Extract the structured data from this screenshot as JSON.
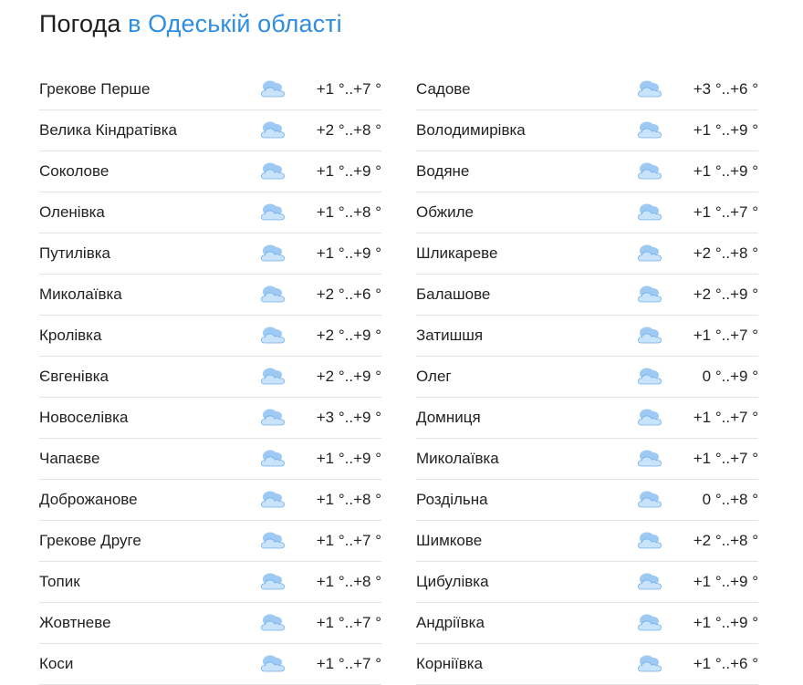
{
  "header": {
    "title_prefix": "Погода",
    "title_region": "в Одеській області"
  },
  "icon": {
    "name": "cloudy-icon",
    "cloud_back": "#9ec9f2",
    "cloud_front": "#c9e3fa",
    "cloud_stroke": "#6fb0ec"
  },
  "left": [
    {
      "city": "Грекове Перше",
      "temp": "+1 °..+7 °"
    },
    {
      "city": "Велика Кіндратівка",
      "temp": "+2 °..+8 °"
    },
    {
      "city": "Соколове",
      "temp": "+1 °..+9 °"
    },
    {
      "city": "Оленівка",
      "temp": "+1 °..+8 °"
    },
    {
      "city": "Путилівка",
      "temp": "+1 °..+9 °"
    },
    {
      "city": "Миколаївка",
      "temp": "+2 °..+6 °"
    },
    {
      "city": "Кролівка",
      "temp": "+2 °..+9 °"
    },
    {
      "city": "Євгенівка",
      "temp": "+2 °..+9 °"
    },
    {
      "city": "Новоселівка",
      "temp": "+3 °..+9 °"
    },
    {
      "city": "Чапаєве",
      "temp": "+1 °..+9 °"
    },
    {
      "city": "Доброжанове",
      "temp": "+1 °..+8 °"
    },
    {
      "city": "Грекове Друге",
      "temp": "+1 °..+7 °"
    },
    {
      "city": "Топик",
      "temp": "+1 °..+8 °"
    },
    {
      "city": "Жовтневе",
      "temp": "+1 °..+7 °"
    },
    {
      "city": "Коси",
      "temp": "+1 °..+7 °"
    }
  ],
  "right": [
    {
      "city": "Садове",
      "temp": "+3 °..+6 °"
    },
    {
      "city": "Володимирівка",
      "temp": "+1 °..+9 °"
    },
    {
      "city": "Водяне",
      "temp": "+1 °..+9 °"
    },
    {
      "city": "Обжиле",
      "temp": "+1 °..+7 °"
    },
    {
      "city": "Шликареве",
      "temp": "+2 °..+8 °"
    },
    {
      "city": "Балашове",
      "temp": "+2 °..+9 °"
    },
    {
      "city": "Затишшя",
      "temp": "+1 °..+7 °"
    },
    {
      "city": "Олег",
      "temp": "0 °..+9 °"
    },
    {
      "city": "Домниця",
      "temp": "+1 °..+7 °"
    },
    {
      "city": "Миколаївка",
      "temp": "+1 °..+7 °"
    },
    {
      "city": "Роздільна",
      "temp": "0 °..+8 °"
    },
    {
      "city": "Шимкове",
      "temp": "+2 °..+8 °"
    },
    {
      "city": "Цибулівка",
      "temp": "+1 °..+9 °"
    },
    {
      "city": "Андріївка",
      "temp": "+1 °..+9 °"
    },
    {
      "city": "Корніївка",
      "temp": "+1 °..+6 °"
    }
  ]
}
